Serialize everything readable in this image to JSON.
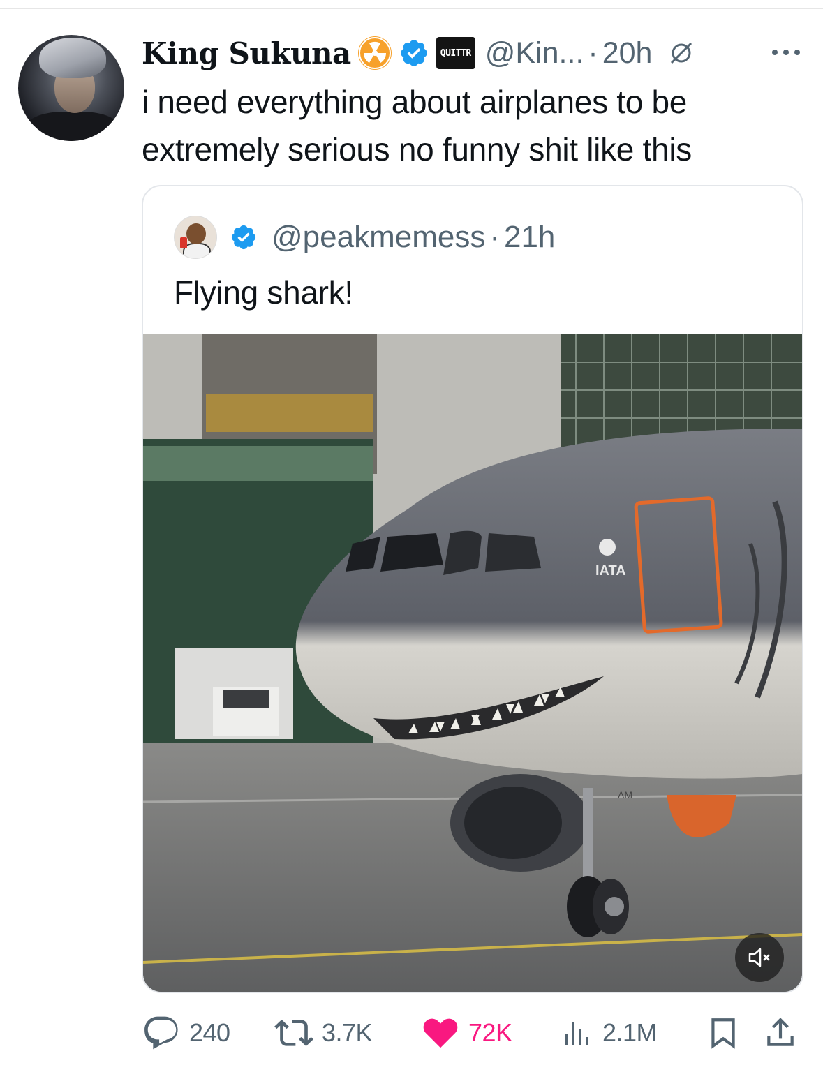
{
  "tweet": {
    "display_name": "King Sukuna",
    "badge_hazard_icon": "radioactive-icon",
    "verified_icon": "verified-badge-icon",
    "affiliate_badge": "QUITTR",
    "handle": "@Kin...",
    "separator": "·",
    "time": "20h",
    "text": "i need everything about airplanes to be extremely serious no funny shit like this"
  },
  "quote": {
    "handle": "@peakmemess",
    "separator": "·",
    "time": "21h",
    "text": "Flying shark!",
    "media": {
      "type": "video",
      "muted": true,
      "fuselage_label": "IATA",
      "gear_label": "AM"
    }
  },
  "actions": {
    "replies": "240",
    "reposts": "3.7K",
    "likes": "72K",
    "views": "2.1M"
  },
  "colors": {
    "secondary_text": "#536471",
    "like_pink": "#f91880",
    "verified_blue": "#1d9bf0",
    "hazard_orange": "#f7a12b"
  }
}
